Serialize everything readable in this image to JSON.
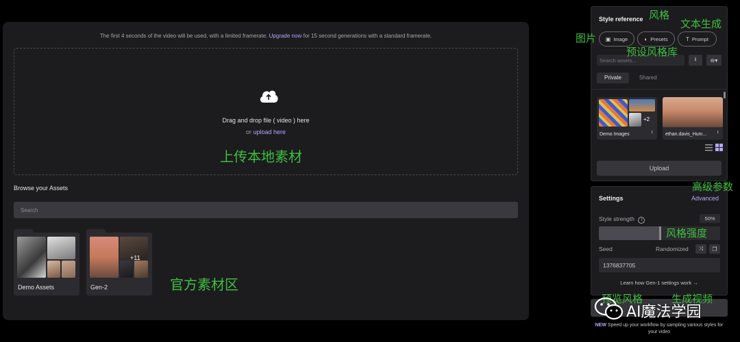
{
  "main": {
    "notice": {
      "before": "The first 4 seconds of the video will be used, with a limited framerate.",
      "link": "Upgrade now",
      "after": "for 15 second generations with a standard framerate."
    },
    "dropzone": {
      "title": "Drag and drop file ( video ) here",
      "or": "or",
      "upload_link": "upload here"
    },
    "browse_title": "Browse your Assets",
    "search_placeholder": "Search",
    "folders": [
      {
        "label": "Demo Assets"
      },
      {
        "label": "Gen-2",
        "badge": "+11"
      }
    ]
  },
  "style_reference": {
    "title": "Style reference",
    "pills": [
      {
        "label": "Image",
        "icon": "image-icon"
      },
      {
        "label": "Presets",
        "icon": "palette-icon"
      },
      {
        "label": "Prompt",
        "icon": "text-icon"
      }
    ],
    "search_placeholder": "Search assets...",
    "tabs": [
      "Private",
      "Shared"
    ],
    "active_tab": "Private",
    "cards": [
      {
        "caption": "Demo Images",
        "badge": "+2"
      },
      {
        "caption": "ethan.davis_Hum..."
      }
    ],
    "upload_label": "Upload"
  },
  "settings": {
    "title": "Settings",
    "advanced_label": "Advanced",
    "style_strength_label": "Style strength",
    "style_strength_value": "50%",
    "style_strength_fraction": 0.5,
    "seed_label": "Seed",
    "randomized_label": "Randomized",
    "seed_value": "1376837705",
    "learn_link": "Learn how Gen-1 settings work"
  },
  "footer": {
    "new_badge": "NEW",
    "text": "Speed up your workflow by sampling various styles for your video"
  },
  "annotations": {
    "upload_local": "上传本地素材",
    "official_assets": "官方素材区",
    "style": "风格",
    "text_gen": "文本生成",
    "image": "图片",
    "preset_lib": "预设风格库",
    "advanced_params": "高级参数",
    "style_strength": "风格强度",
    "preview_style": "预览风格",
    "gen_video": "生成视频",
    "watermark": "AI魔法学园"
  },
  "colors": {
    "accent": "#b7a7ff",
    "annotation": "#3fbf3f",
    "panel": "#1c1c1e"
  }
}
